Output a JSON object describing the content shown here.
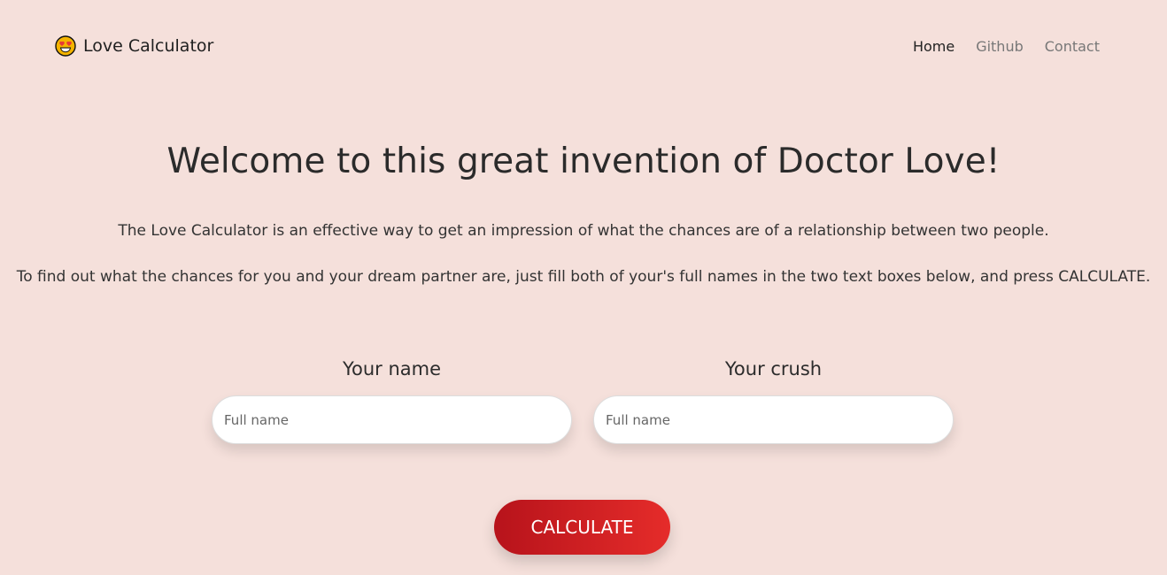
{
  "navbar": {
    "brand_label": "Love Calculator",
    "links": [
      {
        "label": "Home",
        "active": true
      },
      {
        "label": "Github",
        "active": false
      },
      {
        "label": "Contact",
        "active": false
      }
    ]
  },
  "hero": {
    "title": "Welcome to this great invention of Doctor Love!",
    "intro_1": "The Love Calculator is an effective way to get an impression of what the chances are of a relationship between two people.",
    "intro_2": "To find out what the chances for you and your dream partner are, just fill both of your's full names in the two text boxes below, and press CALCULATE."
  },
  "form": {
    "your_name_label": "Your name",
    "your_name_placeholder": "Full name",
    "your_crush_label": "Your crush",
    "your_crush_placeholder": "Full name",
    "calculate_label": "CALCULATE"
  },
  "colors": {
    "background": "#f5e0db",
    "button_gradient_start": "#b7131b",
    "button_gradient_end": "#e52c2a"
  },
  "icons": {
    "brand": "heart-eyes-emoji-icon"
  }
}
